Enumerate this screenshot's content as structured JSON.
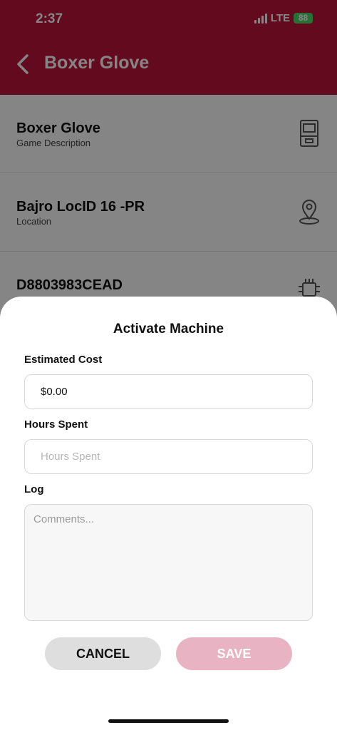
{
  "status_bar": {
    "time": "2:37",
    "network": "LTE",
    "battery": "88"
  },
  "nav": {
    "title": "Boxer Glove"
  },
  "list": [
    {
      "title": "Boxer Glove",
      "subtitle": "Game Description",
      "icon": "arcade-machine-icon"
    },
    {
      "title": "Bajro LocID 16 -PR",
      "subtitle": "Location",
      "icon": "map-pin-icon"
    },
    {
      "title": "D8803983CEAD",
      "subtitle": "",
      "icon": "chip-icon"
    }
  ],
  "sheet": {
    "title": "Activate Machine",
    "estimated_cost": {
      "label": "Estimated Cost",
      "value": "$0.00"
    },
    "hours_spent": {
      "label": "Hours Spent",
      "value": "",
      "placeholder": "Hours Spent"
    },
    "log": {
      "label": "Log",
      "value": "",
      "placeholder": "Comments..."
    },
    "cancel_label": "CANCEL",
    "save_label": "SAVE"
  },
  "colors": {
    "brand": "#c0143c",
    "save_disabled": "#e8b4c3",
    "cancel": "#dedede"
  }
}
